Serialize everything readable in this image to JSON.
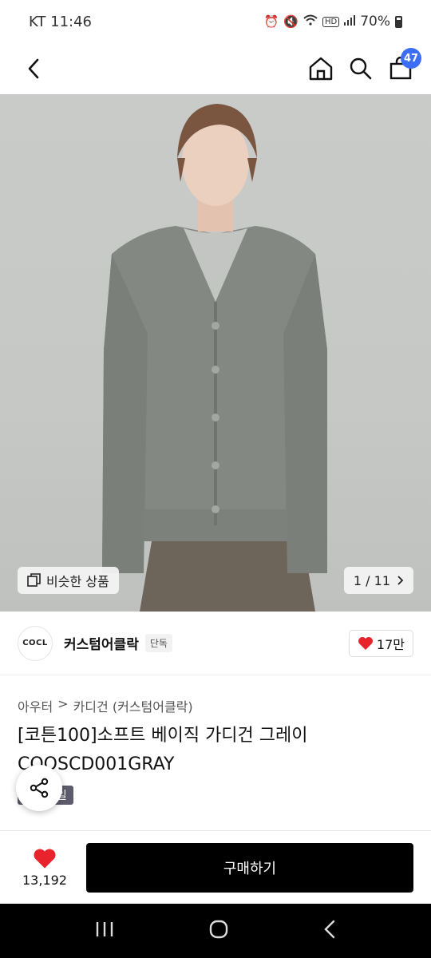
{
  "status_bar": {
    "carrier_time": "KT 11:46",
    "battery": "70%"
  },
  "header": {
    "cart_count": "47"
  },
  "image": {
    "similar_label": "비슷한 상품",
    "page_indicator": "1 / 11"
  },
  "brand": {
    "logo_text": "COCL",
    "name": "커스텀어클락",
    "tag": "단독",
    "likes": "17만"
  },
  "breadcrumb": {
    "level1": "아우터",
    "separator": ">",
    "level2": "카디건 (커스텀어클락)"
  },
  "product": {
    "title": "[코튼100]소프트 베이직 가디건 그레이 COOSCD001GRAY",
    "promo_badge": "세일"
  },
  "bottom_bar": {
    "like_count": "13,192",
    "buy_label": "구매하기"
  },
  "colors": {
    "accent": "#3b6df6",
    "heart": "#e8232b",
    "buy_button": "#000000"
  }
}
